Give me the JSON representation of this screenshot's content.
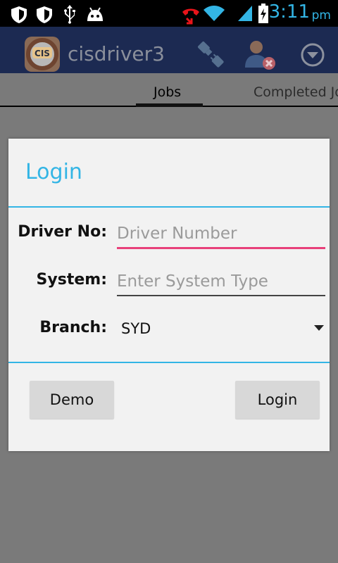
{
  "status_bar": {
    "time": "3:11",
    "ampm": "pm",
    "icons": [
      "shield-icon",
      "shield-half-icon",
      "usb-icon",
      "android-debug-icon",
      "missed-call-icon",
      "wifi-icon",
      "signal-icon",
      "battery-charging-icon"
    ]
  },
  "action_bar": {
    "app_logo_text": "CIS",
    "title": "cisdriver3",
    "icons": [
      "plug-connect-icon",
      "user-remove-icon",
      "overflow-dropdown-icon"
    ]
  },
  "tabs": [
    {
      "label": "Jobs",
      "selected": true
    },
    {
      "label": "Completed Jo",
      "selected": false
    }
  ],
  "dialog": {
    "title": "Login",
    "accent_color": "#33b5e5",
    "fields": {
      "driver_no": {
        "label": "Driver No:",
        "placeholder": "Driver Number",
        "value": ""
      },
      "system": {
        "label": "System:",
        "placeholder": "Enter System Type",
        "value": ""
      },
      "branch": {
        "label": "Branch:",
        "value": "SYD"
      }
    },
    "buttons": {
      "demo": "Demo",
      "login": "Login"
    }
  }
}
